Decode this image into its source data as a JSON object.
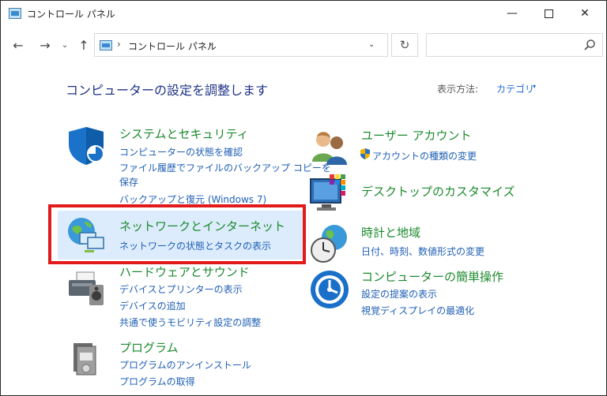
{
  "window": {
    "title": "コントロール パネル",
    "controls": {
      "minimize": "—",
      "close": "✕"
    }
  },
  "address_bar": {
    "separator": "›",
    "path": "コントロール パネル",
    "dropdown": "⌄",
    "refresh": "↻",
    "search_placeholder": ""
  },
  "nav": {
    "back": "←",
    "forward": "→",
    "history": "⌄",
    "up": "↑"
  },
  "page": {
    "heading": "コンピューターの設定を調整します",
    "view_by_label": "表示方法:",
    "view_by_value": "カテゴリ",
    "view_by_caret": "▾"
  },
  "categories": [
    {
      "title": "システムとセキュリティ",
      "icon": "shield-icon",
      "links": [
        "コンピューターの状態を確認",
        "ファイル履歴でファイルのバックアップ コピーを",
        "保存",
        "バックアップと復元 (Windows 7)"
      ]
    },
    {
      "title": "ネットワークとインターネット",
      "icon": "network-globe-icon",
      "links": [
        "ネットワークの状態とタスクの表示"
      ]
    },
    {
      "title": "ハードウェアとサウンド",
      "icon": "printer-speaker-icon",
      "links": [
        "デバイスとプリンターの表示",
        "デバイスの追加",
        "共通で使うモビリティ設定の調整"
      ]
    },
    {
      "title": "プログラム",
      "icon": "programs-icon",
      "links": [
        "プログラムのアンインストール",
        "プログラムの取得"
      ]
    },
    {
      "title": "ユーザー アカウント",
      "icon": "users-icon",
      "links": [
        "アカウントの種類の変更"
      ]
    },
    {
      "title": "デスクトップのカスタマイズ",
      "icon": "monitor-color-icon",
      "links": []
    },
    {
      "title": "時計と地域",
      "icon": "clock-globe-icon",
      "links": [
        "日付、時刻、数値形式の変更"
      ]
    },
    {
      "title": "コンピューターの簡単操作",
      "icon": "ease-of-access-icon",
      "links": [
        "設定の提案の表示",
        "視覚ディスプレイの最適化"
      ]
    }
  ],
  "colors": {
    "category_title": "#1c8a2e",
    "link": "#1f5fb5",
    "heading": "#1e3287",
    "highlight": "#e11b1b"
  }
}
